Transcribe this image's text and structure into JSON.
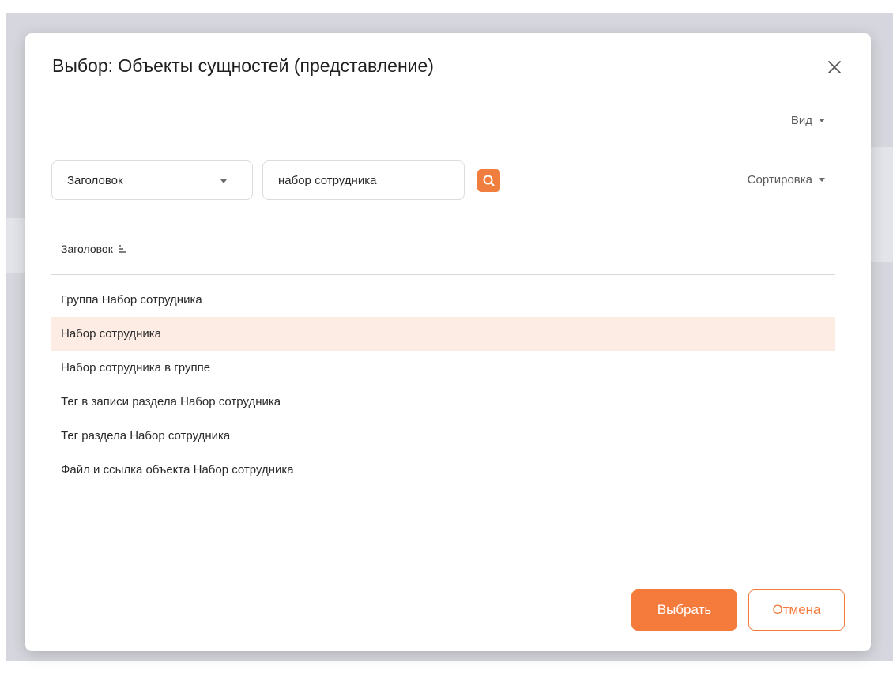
{
  "dialog": {
    "title": "Выбор: Объекты сущностей (представление)",
    "close_icon": "close-icon"
  },
  "toolbar": {
    "view_label": "Вид",
    "sort_label": "Сортировка"
  },
  "filter": {
    "column_selected": "Заголовок",
    "search_value": "набор сотрудника",
    "search_icon": "search-icon"
  },
  "table": {
    "column_header": "Заголовок",
    "sort_icon": "sort-ascending-icon",
    "rows": [
      "Группа Набор сотрудника",
      "Набор сотрудника",
      "Набор сотрудника в группе",
      "Тег в записи раздела Набор сотрудника",
      "Тег раздела Набор сотрудника",
      "Файл и ссылка объекта Набор сотрудника"
    ],
    "selected_row": "Набор сотрудника"
  },
  "actions": {
    "select_label": "Выбрать",
    "cancel_label": "Отмена"
  },
  "colors": {
    "accent": "#f57b3d",
    "selected_row_bg": "#fdece4"
  }
}
